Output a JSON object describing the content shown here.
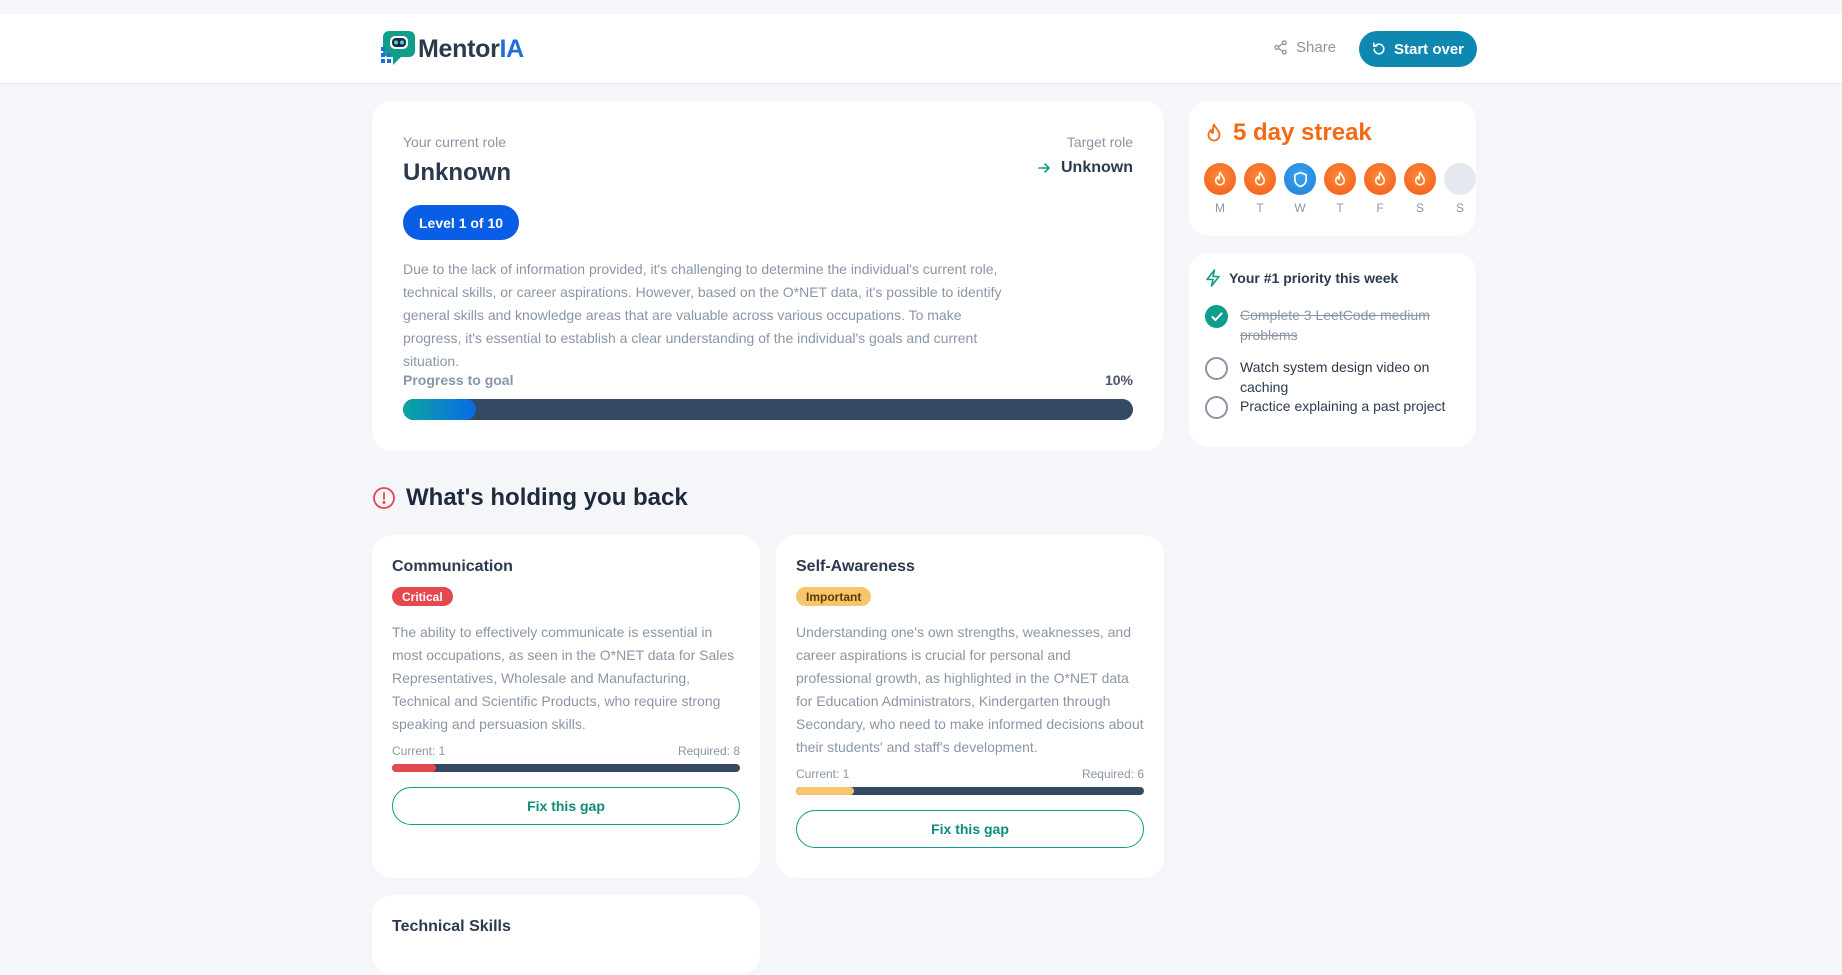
{
  "header": {
    "logo_main": "Mentor",
    "logo_accent": "IA",
    "share_label": "Share",
    "start_over_label": "Start over"
  },
  "role": {
    "current_label": "Your current role",
    "current_value": "Unknown",
    "target_label": "Target role",
    "target_value": "Unknown",
    "level_badge": "Level 1 of 10",
    "description": "Due to the lack of information provided, it's challenging to determine the individual's current role, technical skills, or career aspirations. However, based on the O*NET data, it's possible to identify general skills and knowledge areas that are valuable across various occupations. To make progress, it's essential to establish a clear understanding of the individual's goals and current situation.",
    "progress_label": "Progress to goal",
    "progress_text": "10%",
    "progress_fraction": 0.1
  },
  "streak": {
    "title": "5 day streak",
    "days": [
      {
        "label": "M",
        "state": "fire"
      },
      {
        "label": "T",
        "state": "fire"
      },
      {
        "label": "W",
        "state": "shield"
      },
      {
        "label": "T",
        "state": "fire"
      },
      {
        "label": "F",
        "state": "fire"
      },
      {
        "label": "S",
        "state": "fire"
      },
      {
        "label": "S",
        "state": "empty"
      }
    ]
  },
  "priority": {
    "title": "Your #1 priority this week",
    "tasks": [
      {
        "label": "Complete 3 LeetCode medium problems",
        "done": true
      },
      {
        "label": "Watch system design video on caching",
        "done": false
      },
      {
        "label": "Practice explaining a past project",
        "done": false
      }
    ]
  },
  "gaps": {
    "section_title": "What's holding you back",
    "items": [
      {
        "title": "Communication",
        "badge": "Critical",
        "description": "The ability to effectively communicate is essential in most occupations, as seen in the O*NET data for Sales Representatives, Wholesale and Manufacturing, Technical and Scientific Products, who require strong speaking and persuasion skills.",
        "current_text": "Current: 1",
        "required_text": "Required: 8",
        "current": 1,
        "required": 8,
        "fix_label": "Fix this gap"
      },
      {
        "title": "Self-Awareness",
        "badge": "Important",
        "description": "Understanding one's own strengths, weaknesses, and career aspirations is crucial for personal and professional growth, as highlighted in the O*NET data for Education Administrators, Kindergarten through Secondary, who need to make informed decisions about their students' and staff's development.",
        "current_text": "Current: 1",
        "required_text": "Required: 6",
        "current": 1,
        "required": 6,
        "fix_label": "Fix this gap"
      },
      {
        "title": "Technical Skills"
      }
    ]
  },
  "colors": {
    "accent_teal": "#0e9e8a",
    "primary_blue": "#0a5ee6",
    "streak_orange": "#f26a13",
    "critical_red": "#e5484d",
    "important_yellow": "#f7c66b"
  }
}
